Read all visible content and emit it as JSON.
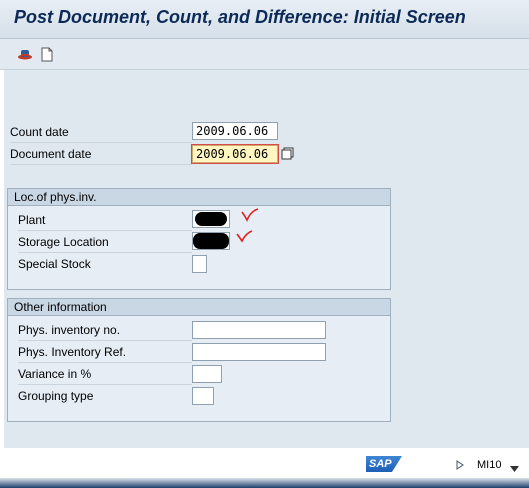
{
  "window": {
    "title": "Post Document, Count, and Difference: Initial Screen"
  },
  "toolbar": {
    "icons": [
      "hat-icon",
      "new-document-icon"
    ]
  },
  "header_fields": {
    "count_date": {
      "label": "Count date",
      "value": "2009.06.06"
    },
    "document_date": {
      "label": "Document date",
      "value": "2009.06.06"
    }
  },
  "loc_group": {
    "title": "Loc.of phys.inv.",
    "plant_label": "Plant",
    "storage_label": "Storage Location",
    "special_stock_label": "Special Stock",
    "plant_value": "",
    "storage_value": "",
    "special_stock_value": ""
  },
  "other_group": {
    "title": "Other information",
    "phys_inv_no_label": "Phys. inventory no.",
    "phys_inv_ref_label": "Phys. Inventory Ref.",
    "variance_label": "Variance in %",
    "grouping_label": "Grouping type",
    "phys_inv_no_value": "",
    "phys_inv_ref_value": "",
    "variance_value": "",
    "grouping_value": ""
  },
  "status": {
    "logo": "SAP",
    "tcode": "MI10"
  },
  "colors": {
    "title": "#0c2a57",
    "panel": "#dfe7ef",
    "required_field": "#fff6c2",
    "annotation": "#e02020"
  }
}
